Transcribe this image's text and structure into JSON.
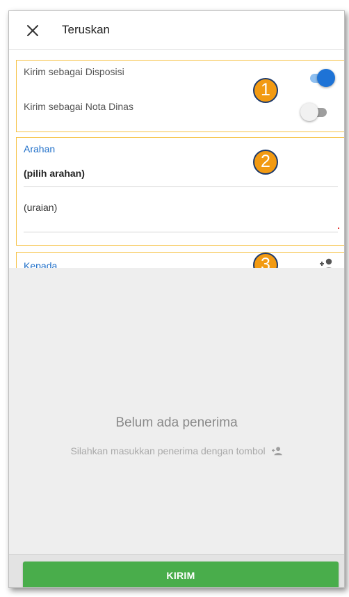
{
  "header": {
    "title": "Teruskan",
    "close_icon": "close-icon"
  },
  "options": {
    "disposisi_label": "Kirim sebagai Disposisi",
    "disposisi_on": true,
    "nota_dinas_label": "Kirim sebagai Nota Dinas",
    "nota_dinas_on": false
  },
  "badges": [
    "1",
    "2",
    "3"
  ],
  "arahan": {
    "label": "Arahan",
    "select_value": "(pilih arahan)",
    "uraian_placeholder": "(uraian)"
  },
  "kepada": {
    "label": "Kepada",
    "add_icon": "add-person-icon"
  },
  "empty": {
    "title": "Belum ada penerima",
    "subtitle": "Silahkan masukkan penerima dengan tombol"
  },
  "footer": {
    "send_label": "KIRIM"
  },
  "colors": {
    "accent_blue": "#1e73d6",
    "highlight_border": "#f6c244",
    "badge_orange": "#f29a12",
    "send_green": "#49ad4b"
  }
}
